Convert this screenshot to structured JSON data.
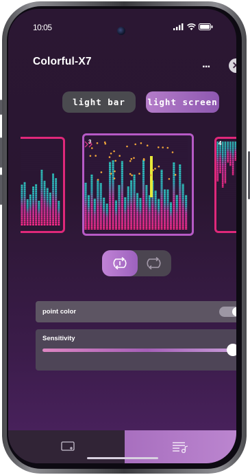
{
  "status_bar": {
    "time": "10:05"
  },
  "header": {
    "title": "Colorful-X7",
    "more_label": "...",
    "close_label": "✕"
  },
  "mode_tabs": [
    {
      "label": "light bar",
      "selected": false
    },
    {
      "label": "light screen",
      "selected": true
    }
  ],
  "effects": [
    {
      "number": "",
      "position": "left"
    },
    {
      "number": "3",
      "position": "center",
      "selected": true
    },
    {
      "number": "4",
      "position": "right"
    }
  ],
  "play_mode": {
    "selected": "single",
    "options": [
      "single",
      "loop"
    ]
  },
  "settings": {
    "point_color": {
      "label": "point color",
      "enabled": true
    },
    "sensitivity": {
      "label": "Sensitivity",
      "value_percent": 100
    }
  },
  "tab_bar": {
    "items": [
      "effects",
      "playlist"
    ],
    "selected": "playlist"
  },
  "colors": {
    "accent": "#e0287a",
    "panel_bg": "#2b1733",
    "active_pill": "#b47cc9"
  }
}
